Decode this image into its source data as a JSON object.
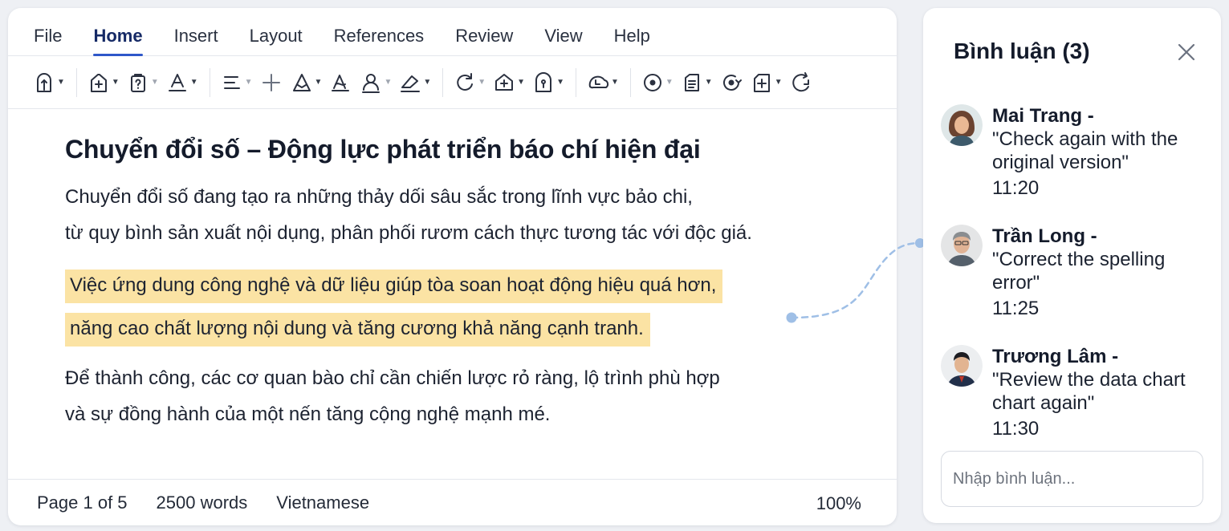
{
  "menu": {
    "items": [
      {
        "label": "File",
        "active": false
      },
      {
        "label": "Home",
        "active": true
      },
      {
        "label": "Insert",
        "active": false
      },
      {
        "label": "Layout",
        "active": false
      },
      {
        "label": "References",
        "active": false
      },
      {
        "label": "Review",
        "active": false
      },
      {
        "label": "View",
        "active": false
      },
      {
        "label": "Help",
        "active": false
      }
    ]
  },
  "toolbar": {
    "icons": [
      "paste-icon",
      "new-page-icon",
      "clipboard-icon",
      "font-color-icon",
      "align-icon",
      "add-icon",
      "text-style-icon",
      "highlight-icon",
      "person-icon",
      "eraser-icon",
      "redo-icon",
      "insert-shape-icon",
      "lock-icon",
      "cloud-icon",
      "record-icon",
      "note-icon",
      "share-icon",
      "add-page-icon",
      "refresh-icon"
    ]
  },
  "document": {
    "title": "Chuyển đổi số – Động lực phát triển báo chí hiện đại",
    "paragraph1": [
      "Chuyển đổi số đang tạo ra những thảy dối sâu sắc trong lĩnh vực bảo chi,",
      "từ quy bình sản xuất nội dụng, phân phối rươm cách thực tương tác với độc giá."
    ],
    "highlighted": [
      "Việc ứng dung công nghệ và dữ liệu giúp tòa soan hoạt động hiệu quá hơn,",
      "năng cao chất lượng nội dung và tăng cương khả năng cạnh tranh."
    ],
    "paragraph3": [
      "Để thành công, các cơ quan bào chỉ cần chiến lược rỏ ràng, lộ trình phù hợp",
      "và sự đồng hành của một nến tăng cộng nghệ mạnh mé."
    ]
  },
  "status": {
    "page": "Page 1 of 5",
    "words": "2500 words",
    "language": "Vietnamese",
    "zoom": "100%"
  },
  "comments": {
    "title": "Bình luận (3)",
    "items": [
      {
        "name": "Mai Trang -",
        "text": "\"Check again with the original version\"",
        "time": "11:20"
      },
      {
        "name": "Trần Long -",
        "text": "\"Correct the spelling error\"",
        "time": "11:25"
      },
      {
        "name": "Trương Lâm -",
        "text": "\"Review the data chart chart again\"",
        "time": "11:30"
      }
    ],
    "input_placeholder": "Nhập bình luận..."
  },
  "colors": {
    "accent": "#2e57c9",
    "highlight": "#fbe3a4",
    "connector": "#9fbfe6"
  }
}
